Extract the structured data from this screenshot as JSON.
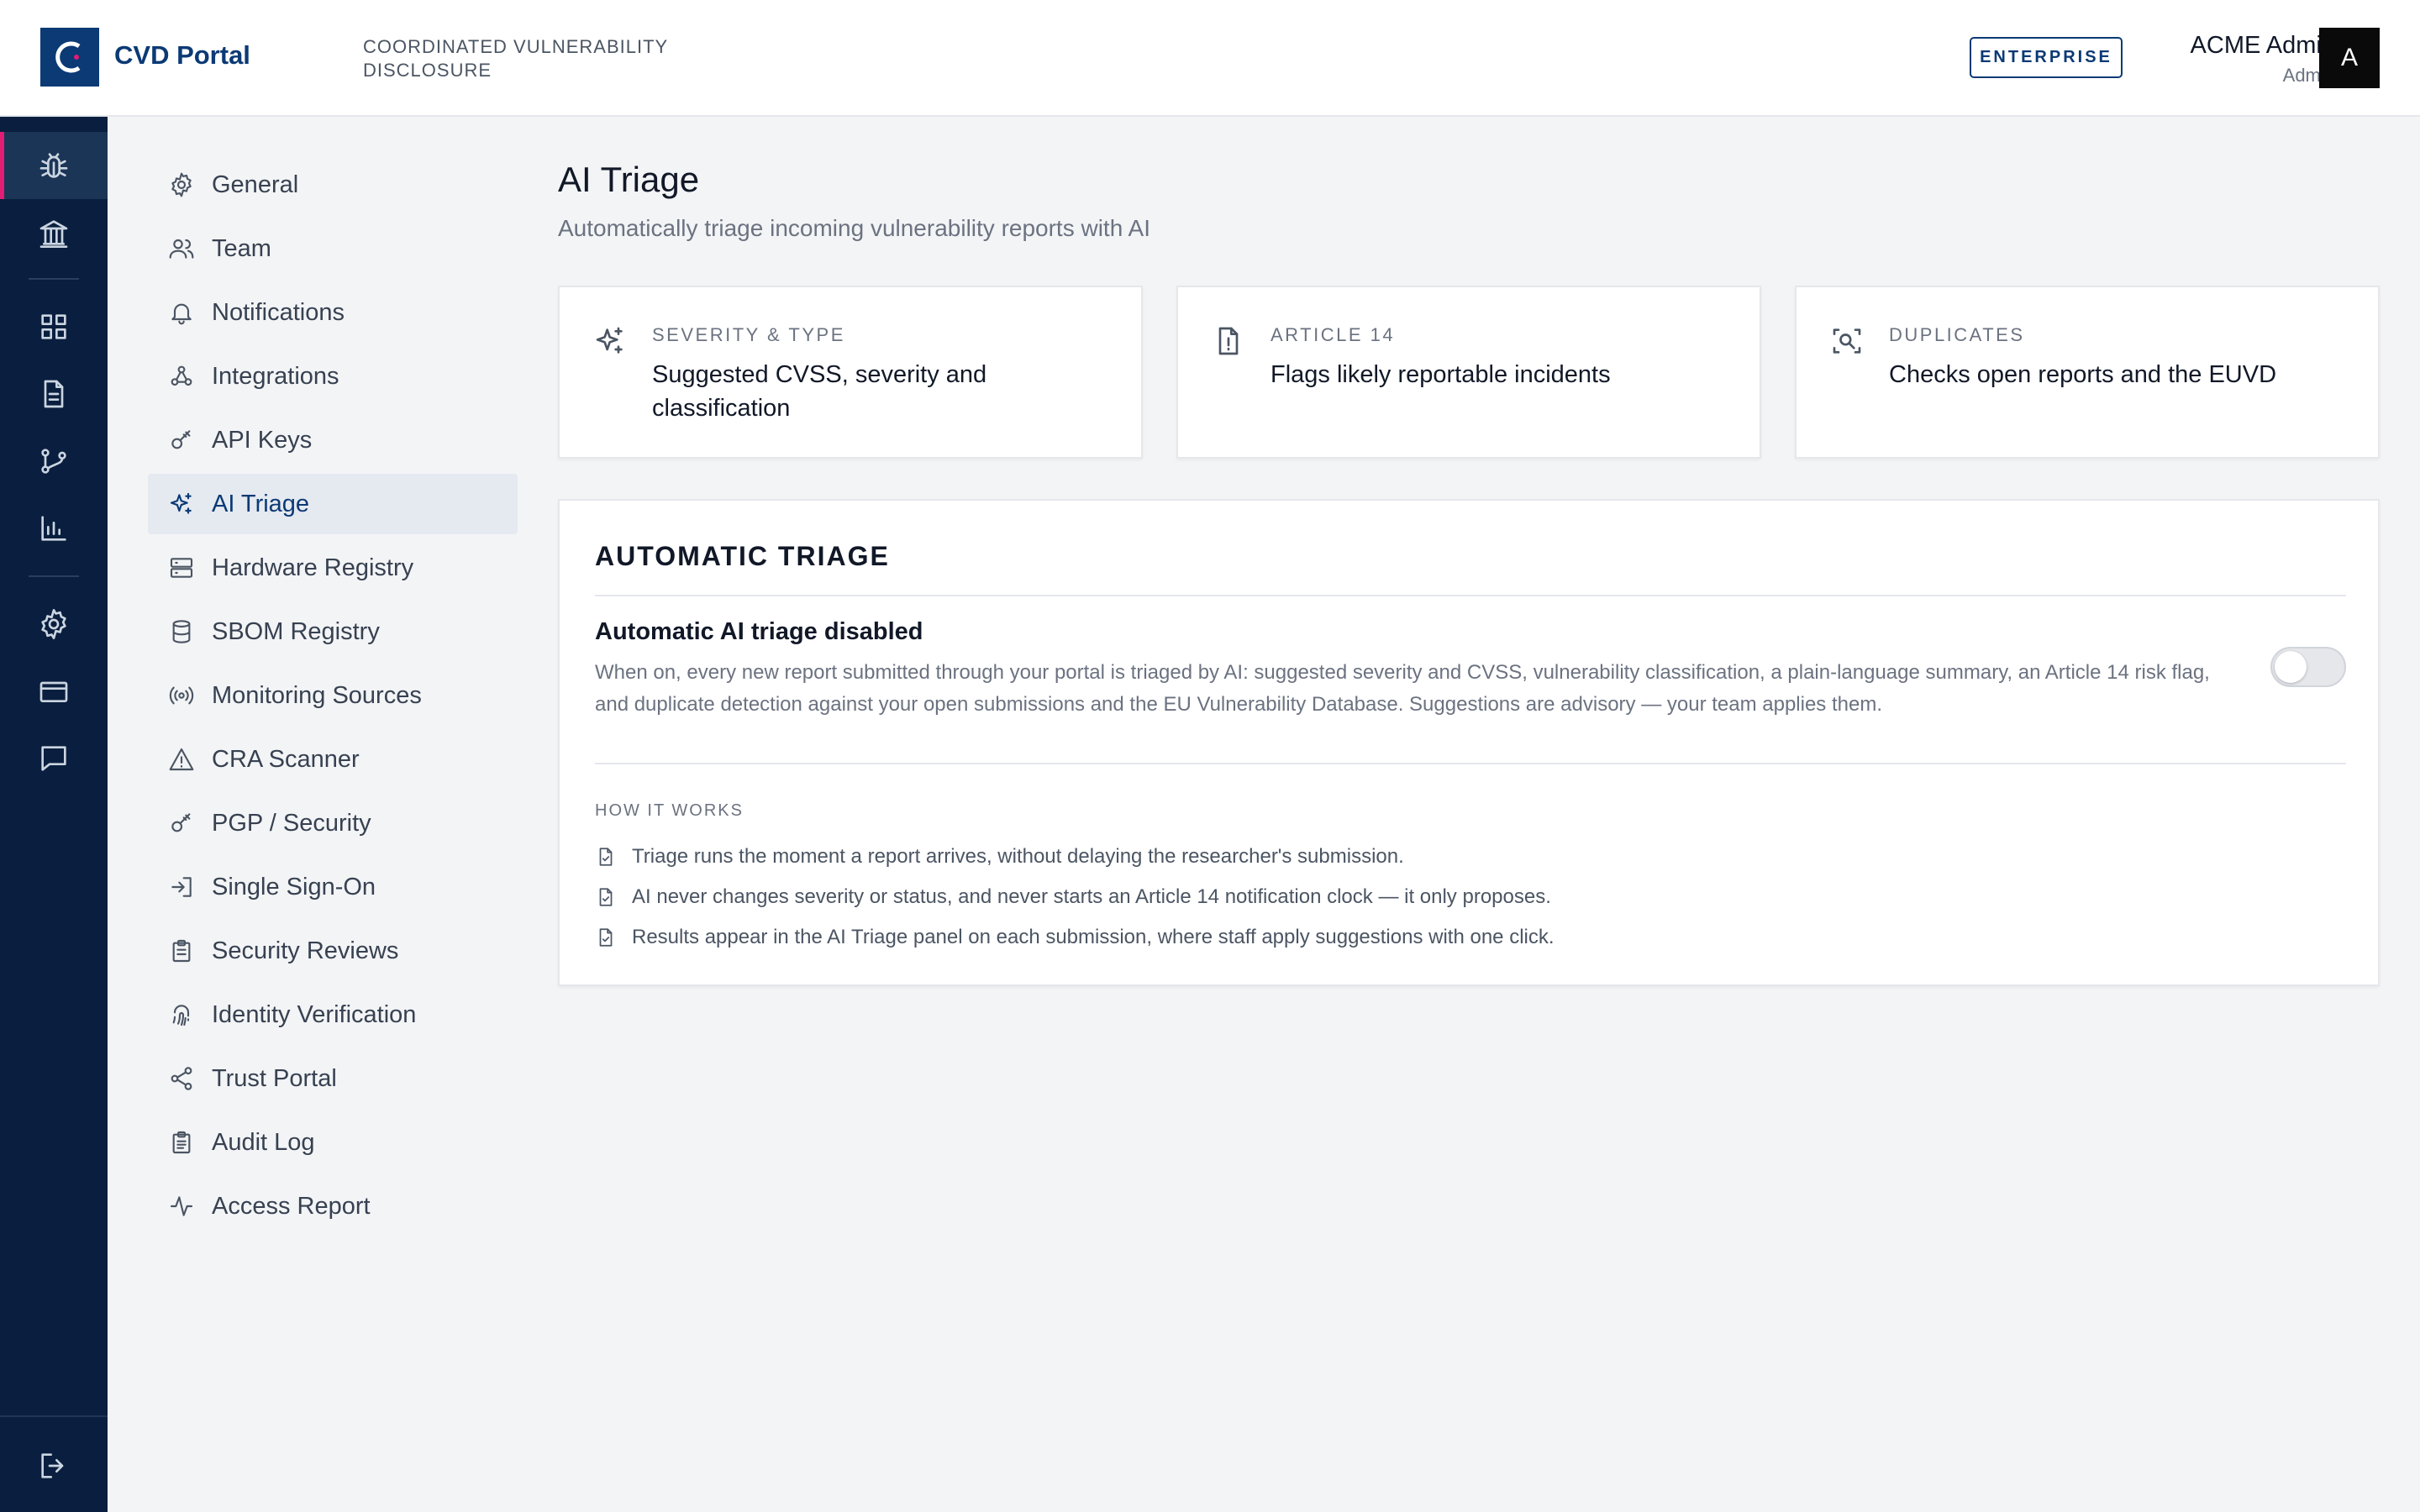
{
  "header": {
    "app_name": "CVD Portal",
    "subtitle": "COORDINATED VULNERABILITY DISCLOSURE",
    "plan_badge": "ENTERPRISE",
    "user_name": "ACME Admin",
    "user_role": "Admin",
    "avatar_initial": "A"
  },
  "rail": {
    "items": [
      {
        "icon": "bug-icon",
        "active": true
      },
      {
        "icon": "bank-icon"
      },
      {
        "icon": "dashboard-icon"
      },
      {
        "icon": "document-icon"
      },
      {
        "icon": "branch-icon"
      },
      {
        "icon": "chart-icon"
      },
      {
        "icon": "gear-icon"
      },
      {
        "icon": "card-icon"
      },
      {
        "icon": "chat-icon"
      },
      {
        "icon": "logout-icon"
      }
    ]
  },
  "subnav": {
    "items": [
      {
        "label": "General",
        "icon": "gear-icon"
      },
      {
        "label": "Team",
        "icon": "users-icon"
      },
      {
        "label": "Notifications",
        "icon": "bell-icon"
      },
      {
        "label": "Integrations",
        "icon": "webhook-icon"
      },
      {
        "label": "API Keys",
        "icon": "key-icon"
      },
      {
        "label": "AI Triage",
        "icon": "sparkles-icon",
        "active": true
      },
      {
        "label": "Hardware Registry",
        "icon": "server-icon"
      },
      {
        "label": "SBOM Registry",
        "icon": "database-icon"
      },
      {
        "label": "Monitoring Sources",
        "icon": "radio-icon"
      },
      {
        "label": "CRA Scanner",
        "icon": "warning-icon"
      },
      {
        "label": "PGP / Security",
        "icon": "key-icon"
      },
      {
        "label": "Single Sign-On",
        "icon": "login-icon"
      },
      {
        "label": "Security Reviews",
        "icon": "clipboard-icon"
      },
      {
        "label": "Identity Verification",
        "icon": "fingerprint-icon"
      },
      {
        "label": "Trust Portal",
        "icon": "share-icon"
      },
      {
        "label": "Audit Log",
        "icon": "clipboard-list-icon"
      },
      {
        "label": "Access Report",
        "icon": "activity-icon"
      }
    ]
  },
  "main": {
    "title": "AI Triage",
    "subtitle": "Automatically triage incoming vulnerability reports with AI",
    "cards": [
      {
        "kicker": "SEVERITY & TYPE",
        "text": "Suggested CVSS, severity and classification",
        "icon": "sparkles-icon"
      },
      {
        "kicker": "ARTICLE 14",
        "text": "Flags likely reportable incidents",
        "icon": "file-alert-icon"
      },
      {
        "kicker": "DUPLICATES",
        "text": "Checks open reports and the EUVD",
        "icon": "scan-search-icon"
      }
    ],
    "panel": {
      "title": "AUTOMATIC TRIAGE",
      "setting_title": "Automatic AI triage disabled",
      "setting_desc": "When on, every new report submitted through your portal is triaged by AI: suggested severity and CVSS, vulnerability classification, a plain-language summary, an Article 14 risk flag, and duplicate detection against your open submissions and the EU Vulnerability Database. Suggestions are advisory — your team applies them.",
      "toggle_on": false,
      "how_label": "HOW IT WORKS",
      "how_items": [
        "Triage runs the moment a report arrives, without delaying the researcher's submission.",
        "AI never changes severity or status, and never starts an Article 14 notification clock — it only proposes.",
        "Results appear in the AI Triage panel on each submission, where staff apply suggestions with one click."
      ]
    }
  },
  "colors": {
    "brand": "#0b3a75",
    "rail_bg": "#0a1f3f",
    "active_accent": "#e11d74"
  }
}
